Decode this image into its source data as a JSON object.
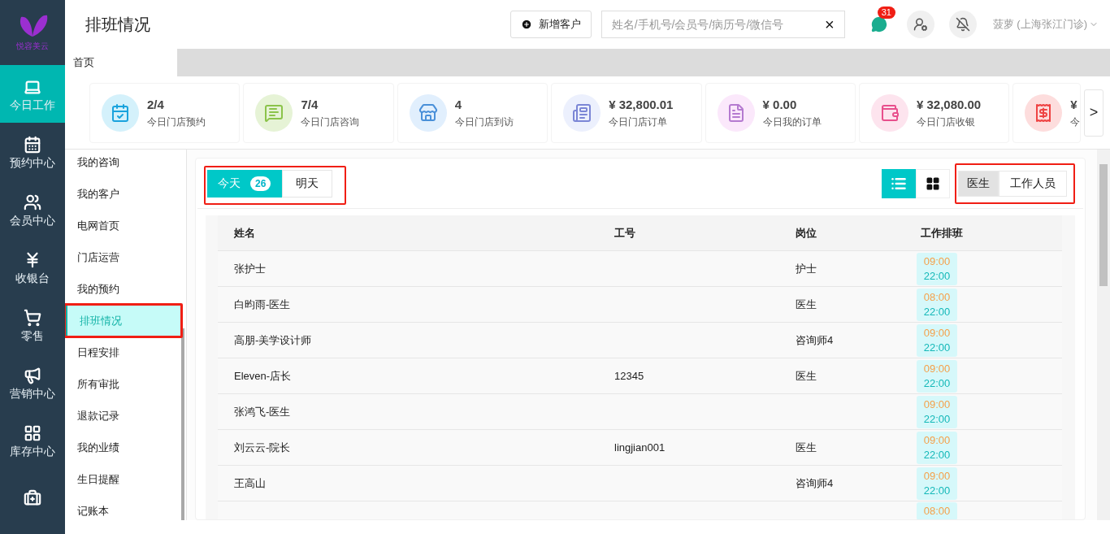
{
  "logo": {
    "text": "悦容美云"
  },
  "nav": [
    {
      "label": "今日工作",
      "selected": true
    },
    {
      "label": "预约中心",
      "selected": false
    },
    {
      "label": "会员中心",
      "selected": false
    },
    {
      "label": "收银台",
      "selected": false
    },
    {
      "label": "零售",
      "selected": false
    },
    {
      "label": "营销中心",
      "selected": false
    },
    {
      "label": "库存中心",
      "selected": false
    },
    {
      "selected": false
    }
  ],
  "header": {
    "title": "排班情况",
    "add_button": "新增客户",
    "search": {
      "placeholder": "姓名/手机号/会员号/病历号/微信号",
      "clear": "×"
    },
    "message_count": "31",
    "user": "菠萝 (上海张江门诊)"
  },
  "tabs": [
    {
      "label": "首页",
      "selected": true
    }
  ],
  "stats": [
    {
      "value": "2/4",
      "label": "今日门店预约"
    },
    {
      "value": "7/4",
      "label": "今日门店咨询"
    },
    {
      "value": "4",
      "label": "今日门店到访"
    },
    {
      "value": "¥ 32,800.01",
      "label": "今日门店订单"
    },
    {
      "value": "¥ 0.00",
      "label": "今日我的订单"
    },
    {
      "value": "¥ 32,080.00",
      "label": "今日门店收银"
    },
    {
      "value": "¥",
      "label": "今"
    }
  ],
  "stats_next": ">",
  "submenu": {
    "items": [
      {
        "label": "我的咨询",
        "selected": false,
        "annotated": false
      },
      {
        "label": "我的客户",
        "selected": false,
        "annotated": false
      },
      {
        "label": "电网首页",
        "selected": false,
        "annotated": false
      },
      {
        "label": "门店运营",
        "selected": false,
        "annotated": false
      },
      {
        "label": "我的预约",
        "selected": false,
        "annotated": false
      },
      {
        "label": "排班情况",
        "selected": true,
        "annotated": true
      },
      {
        "label": "日程安排",
        "selected": false,
        "annotated": false
      },
      {
        "label": "所有审批",
        "selected": false,
        "annotated": false
      },
      {
        "label": "退款记录",
        "selected": false,
        "annotated": false
      },
      {
        "label": "我的业绩",
        "selected": false,
        "annotated": false
      },
      {
        "label": "生日提醒",
        "selected": false,
        "annotated": false
      },
      {
        "label": "记账本",
        "selected": false,
        "annotated": false
      }
    ]
  },
  "day_tabs": {
    "annotated": true,
    "items": [
      {
        "label": "今天",
        "badge": "26",
        "selected": true
      },
      {
        "label": "明天",
        "selected": false
      }
    ]
  },
  "view_toggle": [
    {
      "kind": "list",
      "selected": true
    },
    {
      "kind": "grid",
      "selected": false
    }
  ],
  "role_toggle": {
    "annotated": true,
    "items": [
      {
        "label": "医生",
        "selected": true
      },
      {
        "label": "工作人员",
        "selected": false
      }
    ]
  },
  "table": {
    "columns": [
      "姓名",
      "工号",
      "岗位",
      "工作排班"
    ],
    "rows": [
      {
        "name": "张护士",
        "id": "",
        "role": "护士",
        "start": "09:00",
        "end": "22:00"
      },
      {
        "name": "白昀雨-医生",
        "id": "",
        "role": "医生",
        "start": "08:00",
        "end": "22:00"
      },
      {
        "name": "高朋-美学设计师",
        "id": "",
        "role": "咨询师4",
        "start": "09:00",
        "end": "22:00"
      },
      {
        "name": "Eleven-店长",
        "id": "12345",
        "role": "医生",
        "start": "09:00",
        "end": "22:00"
      },
      {
        "name": "张鸿飞-医生",
        "id": "",
        "role": "",
        "start": "09:00",
        "end": "22:00"
      },
      {
        "name": "刘云云-院长",
        "id": "lingjian001",
        "role": "医生",
        "start": "09:00",
        "end": "22:00"
      },
      {
        "name": "王高山",
        "id": "",
        "role": "咨询师4",
        "start": "09:00",
        "end": "22:00"
      },
      {
        "name": "",
        "id": "",
        "role": "",
        "start": "08:00",
        "end": ""
      }
    ]
  }
}
